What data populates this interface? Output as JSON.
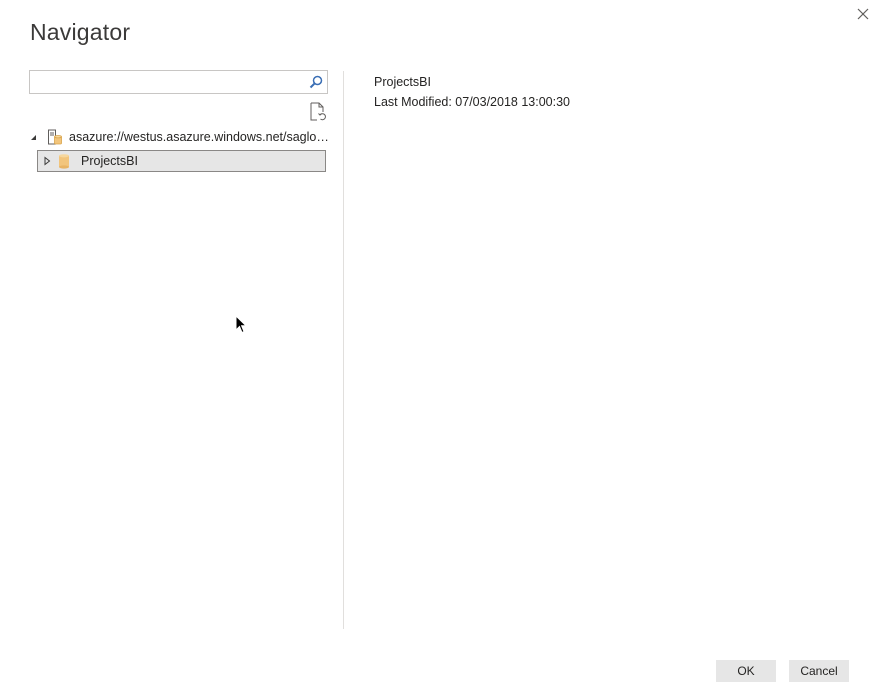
{
  "dialog": {
    "title": "Navigator"
  },
  "search": {
    "placeholder": "",
    "value": ""
  },
  "tree": {
    "root": {
      "label": "asazure://westus.asazure.windows.net/saglobal...",
      "icon": "server-database-icon",
      "expanded": true
    },
    "children": [
      {
        "label": "ProjectsBI",
        "icon": "database-cylinder-icon",
        "expanded": false,
        "selected": true
      }
    ]
  },
  "preview": {
    "name": "ProjectsBI",
    "last_modified": "Last Modified: 07/03/2018 13:00:30"
  },
  "footer": {
    "ok_label": "OK",
    "cancel_label": "Cancel"
  },
  "colors": {
    "selection_bg": "#e6e6e6",
    "selection_border": "#8a8886",
    "db_icon": "#f2c57c",
    "button_bg": "#e6e6e6"
  }
}
